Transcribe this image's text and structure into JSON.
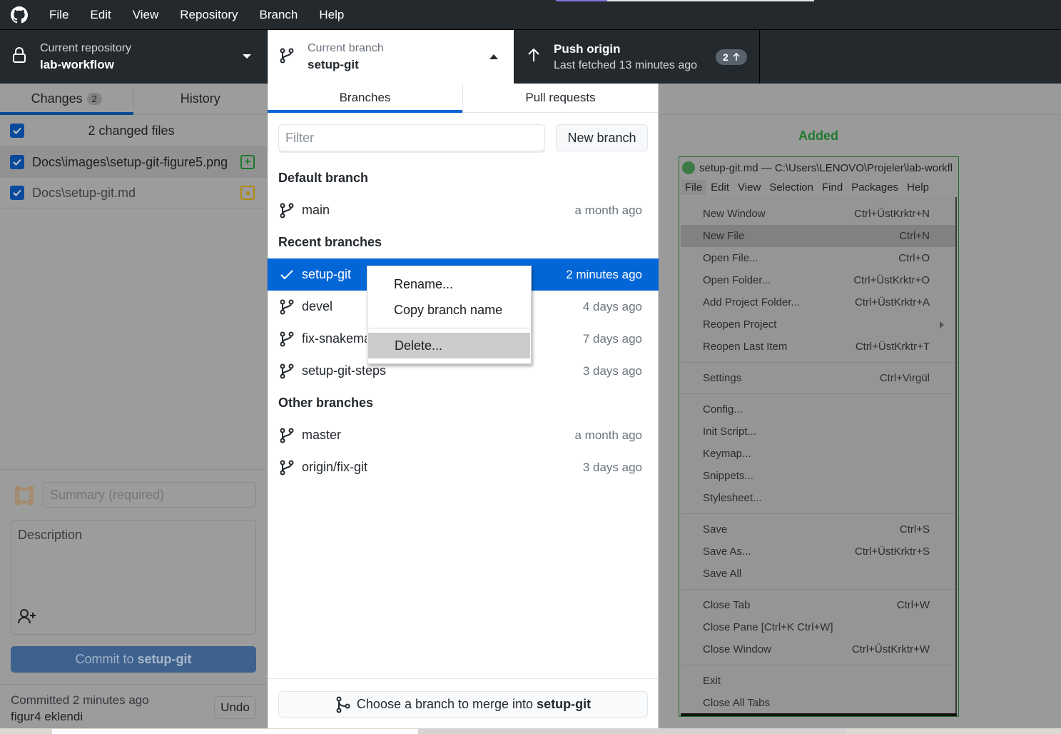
{
  "app": {
    "menu": [
      "File",
      "Edit",
      "View",
      "Repository",
      "Branch",
      "Help"
    ],
    "progress": 0.2
  },
  "toolbar": {
    "repo_label": "Current repository",
    "repo_name": "lab-workflow",
    "branch_label": "Current branch",
    "branch_name": "setup-git",
    "push_label": "Push origin",
    "push_sub": "Last fetched 13 minutes ago",
    "push_count": "2"
  },
  "sidebar": {
    "tabs": [
      {
        "label": "Changes",
        "count": "2"
      },
      {
        "label": "History"
      }
    ],
    "changes_header": "2 changed files",
    "files": [
      {
        "path": "Docs\\images\\setup-git-figure5.png",
        "status": "added"
      },
      {
        "path": "Docs\\setup-git.md",
        "status": "modified"
      }
    ],
    "summary_placeholder": "Summary (required)",
    "description_placeholder": "Description",
    "commit_prefix": "Commit to",
    "commit_branch": "setup-git",
    "last_commit_when": "Committed 2 minutes ago",
    "last_commit_msg": "figur4 eklendi",
    "undo_label": "Undo"
  },
  "branch_panel": {
    "tabs": [
      "Branches",
      "Pull requests"
    ],
    "filter_placeholder": "Filter",
    "new_branch_label": "New branch",
    "groups": [
      {
        "title": "Default branch",
        "branches": [
          {
            "name": "main",
            "time": "a month ago"
          }
        ]
      },
      {
        "title": "Recent branches",
        "branches": [
          {
            "name": "setup-git",
            "time": "2 minutes ago",
            "current": true
          },
          {
            "name": "devel",
            "time": "4 days ago"
          },
          {
            "name": "fix-snakemake",
            "time": "7 days ago"
          },
          {
            "name": "setup-git-steps",
            "time": "3 days ago"
          }
        ]
      },
      {
        "title": "Other branches",
        "branches": [
          {
            "name": "master",
            "time": "a month ago"
          },
          {
            "name": "origin/fix-git",
            "time": "3 days ago"
          }
        ]
      }
    ],
    "merge_prefix": "Choose a branch to merge into",
    "merge_branch": "setup-git"
  },
  "context_menu": {
    "items": [
      "Rename...",
      "Copy branch name",
      "Delete..."
    ],
    "hovered": "Delete..."
  },
  "diff": {
    "status_label": "Added",
    "image": {
      "title": "setup-git.md — C:\\Users\\LENOVO\\Projeler\\lab-workfl",
      "menubar": [
        "File",
        "Edit",
        "View",
        "Selection",
        "Find",
        "Packages",
        "Help"
      ],
      "menu_items": [
        {
          "label": "New Window",
          "shortcut": "Ctrl+ÜstKrktr+N"
        },
        {
          "label": "New File",
          "shortcut": "Ctrl+N",
          "highlight": true
        },
        {
          "label": "Open File...",
          "shortcut": "Ctrl+O"
        },
        {
          "label": "Open Folder...",
          "shortcut": "Ctrl+ÜstKrktr+O"
        },
        {
          "label": "Add Project Folder...",
          "shortcut": "Ctrl+ÜstKrktr+A"
        },
        {
          "label": "Reopen Project",
          "submenu": true
        },
        {
          "label": "Reopen Last Item",
          "shortcut": "Ctrl+ÜstKrktr+T"
        },
        {
          "sep": true
        },
        {
          "label": "Settings",
          "shortcut": "Ctrl+Virgül"
        },
        {
          "sep": true
        },
        {
          "label": "Config..."
        },
        {
          "label": "Init Script..."
        },
        {
          "label": "Keymap..."
        },
        {
          "label": "Snippets..."
        },
        {
          "label": "Stylesheet..."
        },
        {
          "sep": true
        },
        {
          "label": "Save",
          "shortcut": "Ctrl+S"
        },
        {
          "label": "Save As...",
          "shortcut": "Ctrl+ÜstKrktr+S"
        },
        {
          "label": "Save All"
        },
        {
          "sep": true
        },
        {
          "label": "Close Tab",
          "shortcut": "Ctrl+W"
        },
        {
          "label": "Close Pane [Ctrl+K Ctrl+W]"
        },
        {
          "label": "Close Window",
          "shortcut": "Ctrl+ÜstKrktr+W"
        },
        {
          "sep": true
        },
        {
          "label": "Exit"
        },
        {
          "label": "Close All Tabs"
        }
      ]
    }
  },
  "colors": {
    "accent": "#0366d6",
    "toolbar_bg": "#24292e",
    "added": "#1f7a2e",
    "modified": "#b08a12"
  }
}
